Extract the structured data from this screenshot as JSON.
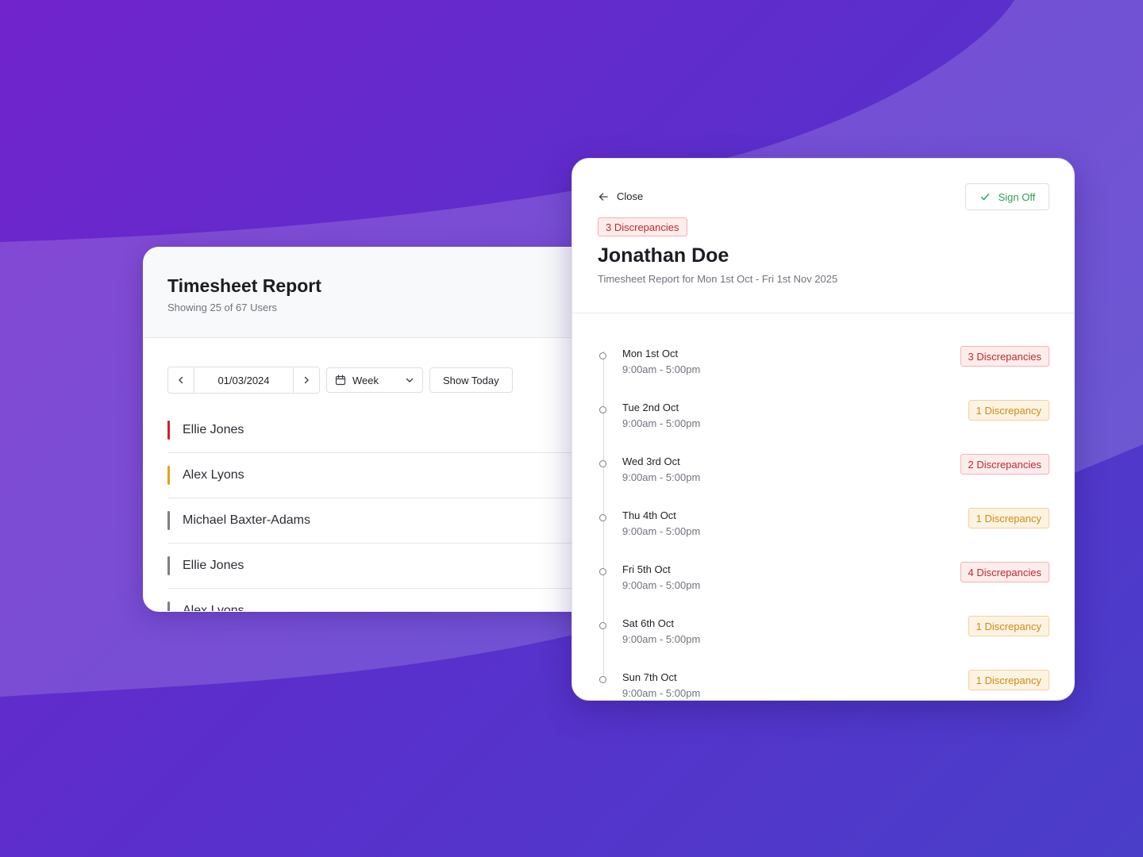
{
  "left_panel": {
    "title": "Timesheet Report",
    "subtitle": "Showing 25 of 67 Users",
    "date_value": "01/03/2024",
    "period_select": "Week",
    "show_today_label": "Show Today",
    "users": [
      {
        "name": "Ellie Jones",
        "status_color": "#d0212b"
      },
      {
        "name": "Alex Lyons",
        "status_color": "#e6a020"
      },
      {
        "name": "Michael Baxter-Adams",
        "status_color": "#7c7f86"
      },
      {
        "name": "Ellie Jones",
        "status_color": "#7c7f86"
      },
      {
        "name": "Alex Lyons",
        "status_color": "#7c7f86"
      }
    ]
  },
  "detail_panel": {
    "close_label": "Close",
    "sign_off_label": "Sign Off",
    "discrepancy_chip": "3 Discrepancies",
    "person_name": "Jonathan Doe",
    "report_range": "Timesheet Report for Mon 1st Oct - Fri 1st Nov 2025",
    "days": [
      {
        "day": "Mon 1st Oct",
        "hours": "9:00am - 5:00pm",
        "badge": "3 Discrepancies",
        "severity": "red"
      },
      {
        "day": "Tue 2nd Oct",
        "hours": "9:00am - 5:00pm",
        "badge": "1 Discrepancy",
        "severity": "amber"
      },
      {
        "day": "Wed 3rd Oct",
        "hours": "9:00am - 5:00pm",
        "badge": "2 Discrepancies",
        "severity": "red"
      },
      {
        "day": "Thu 4th Oct",
        "hours": "9:00am - 5:00pm",
        "badge": "1 Discrepancy",
        "severity": "amber"
      },
      {
        "day": "Fri 5th Oct",
        "hours": "9:00am - 5:00pm",
        "badge": "4 Discrepancies",
        "severity": "red"
      },
      {
        "day": "Sat 6th Oct",
        "hours": "9:00am - 5:00pm",
        "badge": "1 Discrepancy",
        "severity": "amber"
      },
      {
        "day": "Sun 7th Oct",
        "hours": "9:00am - 5:00pm",
        "badge": "1 Discrepancy",
        "severity": "amber"
      }
    ]
  },
  "colors": {
    "background_start": "#7124cc",
    "background_end": "#4a3ec9",
    "danger": "#c02a2a",
    "warning": "#d48a12",
    "success": "#2f9e5a"
  },
  "icons": [
    "chevron-left-icon",
    "chevron-right-icon",
    "calendar-icon",
    "chevron-down-icon",
    "arrow-left-icon",
    "check-icon"
  ]
}
